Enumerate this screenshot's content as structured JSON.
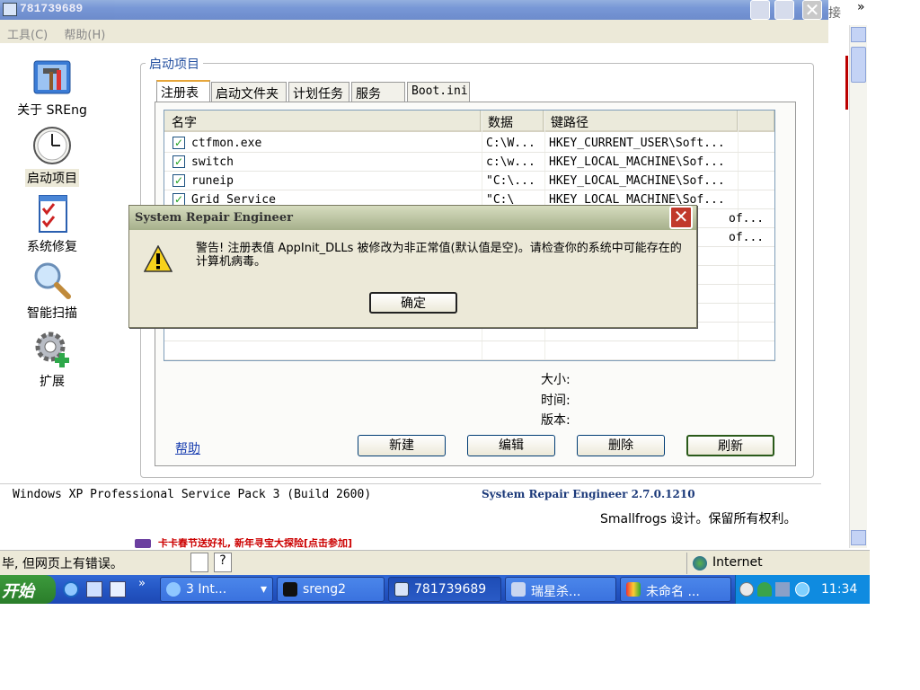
{
  "window": {
    "title": "781739689",
    "menu": [
      "工具(C)",
      "帮助(H)"
    ],
    "close_glyph": "✕"
  },
  "right_fragments": {
    "link": "接",
    "chevrons": "»"
  },
  "sidebar": {
    "items": [
      {
        "label": "关于 SREng",
        "icon": "tools-icon"
      },
      {
        "label": "启动项目",
        "icon": "clock-icon",
        "selected": true
      },
      {
        "label": "系统修复",
        "icon": "checklist-icon"
      },
      {
        "label": "智能扫描",
        "icon": "magnifier-icon"
      },
      {
        "label": "扩展",
        "icon": "gear-plus-icon"
      }
    ]
  },
  "group": {
    "title": "启动项目",
    "tabs": [
      "注册表",
      "启动文件夹",
      "计划任务",
      "服务",
      "Boot.ini"
    ],
    "active_tab": "注册表"
  },
  "list": {
    "columns": [
      "名字",
      "数据",
      "键路径"
    ],
    "rows": [
      {
        "name": "ctfmon.exe",
        "data": "C:\\W...",
        "path": "HKEY_CURRENT_USER\\Soft...",
        "checked": true
      },
      {
        "name": "switch",
        "data": "c:\\w...",
        "path": "HKEY_LOCAL_MACHINE\\Sof...",
        "checked": true
      },
      {
        "name": "runeip",
        "data": "\"C:\\...",
        "path": "HKEY_LOCAL_MACHINE\\Sof...",
        "checked": true
      },
      {
        "name": "Grid Service",
        "data": "\"C:\\",
        "path": "HKEY_LOCAL_MACHINE\\Sof...",
        "checked": true
      }
    ],
    "partial_paths": [
      "of...",
      "of..."
    ]
  },
  "details": {
    "size_label": "大小:",
    "time_label": "时间:",
    "version_label": "版本:"
  },
  "actions": {
    "help": "帮助",
    "new": "新建",
    "edit": "编辑",
    "delete": "删除",
    "refresh": "刷新"
  },
  "footer": {
    "os": "Windows XP Professional Service Pack 3 (Build 2600)",
    "version": "System Repair Engineer 2.7.0.1210",
    "copyright": "Smallfrogs 设计。保留所有权利。",
    "ad_text": "卡卡春节送好礼, 新年寻宝大探险[点击参加]"
  },
  "dialog": {
    "title": "System Repair Engineer",
    "message": "警告! 注册表值 AppInit_DLLs 被修改为非正常值(默认值是空)。请检查你的系统中可能存在的计算机病毒。",
    "ok": "确定",
    "icon": "warning-icon"
  },
  "ie_status": {
    "text": "毕, 但网页上有错误。",
    "zone": "Internet"
  },
  "taskbar": {
    "start": "开始",
    "buttons": [
      {
        "label": "3 Int...",
        "icon": "ie-icon"
      },
      {
        "label": "sreng2",
        "icon": "folder-icon"
      },
      {
        "label": "781739689",
        "icon": "sreng-icon",
        "active": true
      },
      {
        "label": "瑞星杀...",
        "icon": "antivirus-icon"
      },
      {
        "label": "未命名 ...",
        "icon": "paint-icon"
      }
    ],
    "clock": "11:34"
  },
  "colors": {
    "taskbar": "#2456c4",
    "dialog_title": "#a6b08b",
    "window_bg": "#ece9d8"
  }
}
